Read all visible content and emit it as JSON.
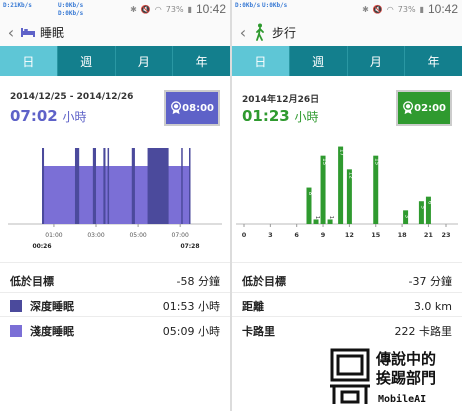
{
  "left": {
    "status": {
      "speed_down": "D:21Kb/s",
      "speed_up": "U:0Kb/s",
      "battery": "73%",
      "time": "10:42"
    },
    "title": "睡眠",
    "icon": "bed-icon",
    "tabs": [
      "日",
      "週",
      "月",
      "年"
    ],
    "active_tab": 0,
    "date": "2014/12/25 - 2014/12/26",
    "total": {
      "value": "07:02",
      "unit": "小時"
    },
    "goal": {
      "value": "08:00",
      "icon": "medal-icon"
    },
    "rows": [
      {
        "label": "低於目標",
        "value": "-58 分鐘"
      },
      {
        "label": "深度睡眠",
        "value": "01:53 小時",
        "color": "#4b4a9c"
      },
      {
        "label": "淺度睡眠",
        "value": "05:09 小時",
        "color": "#7b6fd6"
      }
    ],
    "colors": {
      "accent": "#5e62c8",
      "light_sleep": "#7b6fd6",
      "deep_sleep": "#4b4a9c"
    }
  },
  "right": {
    "status": {
      "speed_down": "D:0Kb/s",
      "speed_up": "U:0Kb/s",
      "battery": "73%",
      "time": "10:42"
    },
    "title": "步行",
    "icon": "walking-person-icon",
    "tabs": [
      "日",
      "週",
      "月",
      "年"
    ],
    "active_tab": 0,
    "date": "2014年12月26日",
    "total": {
      "value": "01:23",
      "unit": "小時"
    },
    "goal": {
      "value": "02:00",
      "icon": "medal-icon"
    },
    "rows": [
      {
        "label": "低於目標",
        "value": "-37 分鐘"
      },
      {
        "label": "距離",
        "value": "3.0 km"
      },
      {
        "label": "卡路里",
        "value": "222 卡路里"
      }
    ],
    "colors": {
      "accent": "#2f9a2f"
    }
  },
  "chart_data": [
    {
      "type": "bar",
      "title": "",
      "x_tick_labels": [
        "01:00",
        "03:00",
        "05:00",
        "07:00"
      ],
      "start_label": "00:26",
      "end_label": "07:28",
      "x_range": [
        0.433,
        7.467
      ],
      "series": [
        {
          "name": "淺度睡眠",
          "segments": [
            [
              0.433,
              7.467
            ]
          ]
        },
        {
          "name": "深度睡眠",
          "segments": [
            [
              0.433,
              0.53
            ],
            [
              2.0,
              2.2
            ],
            [
              2.85,
              3.0
            ],
            [
              3.35,
              3.45
            ],
            [
              3.55,
              3.62
            ],
            [
              4.7,
              4.85
            ],
            [
              5.45,
              6.45
            ],
            [
              7.05,
              7.12
            ],
            [
              7.42,
              7.467
            ]
          ]
        }
      ]
    },
    {
      "type": "bar",
      "title": "",
      "x_ticks": [
        0,
        3,
        6,
        9,
        12,
        15,
        18,
        21,
        23
      ],
      "x_range": [
        0,
        23
      ],
      "bars": [
        {
          "x": 7.4,
          "value": 8
        },
        {
          "x": 8.2,
          "value": 1
        },
        {
          "x": 9.0,
          "value": 15
        },
        {
          "x": 9.8,
          "value": 1
        },
        {
          "x": 11.0,
          "value": 17
        },
        {
          "x": 12.0,
          "value": 12
        },
        {
          "x": 15.0,
          "value": 15
        },
        {
          "x": 18.4,
          "value": 3
        },
        {
          "x": 20.2,
          "value": 5
        },
        {
          "x": 21.0,
          "value": 6
        }
      ],
      "ylim": [
        0,
        18
      ]
    }
  ]
}
